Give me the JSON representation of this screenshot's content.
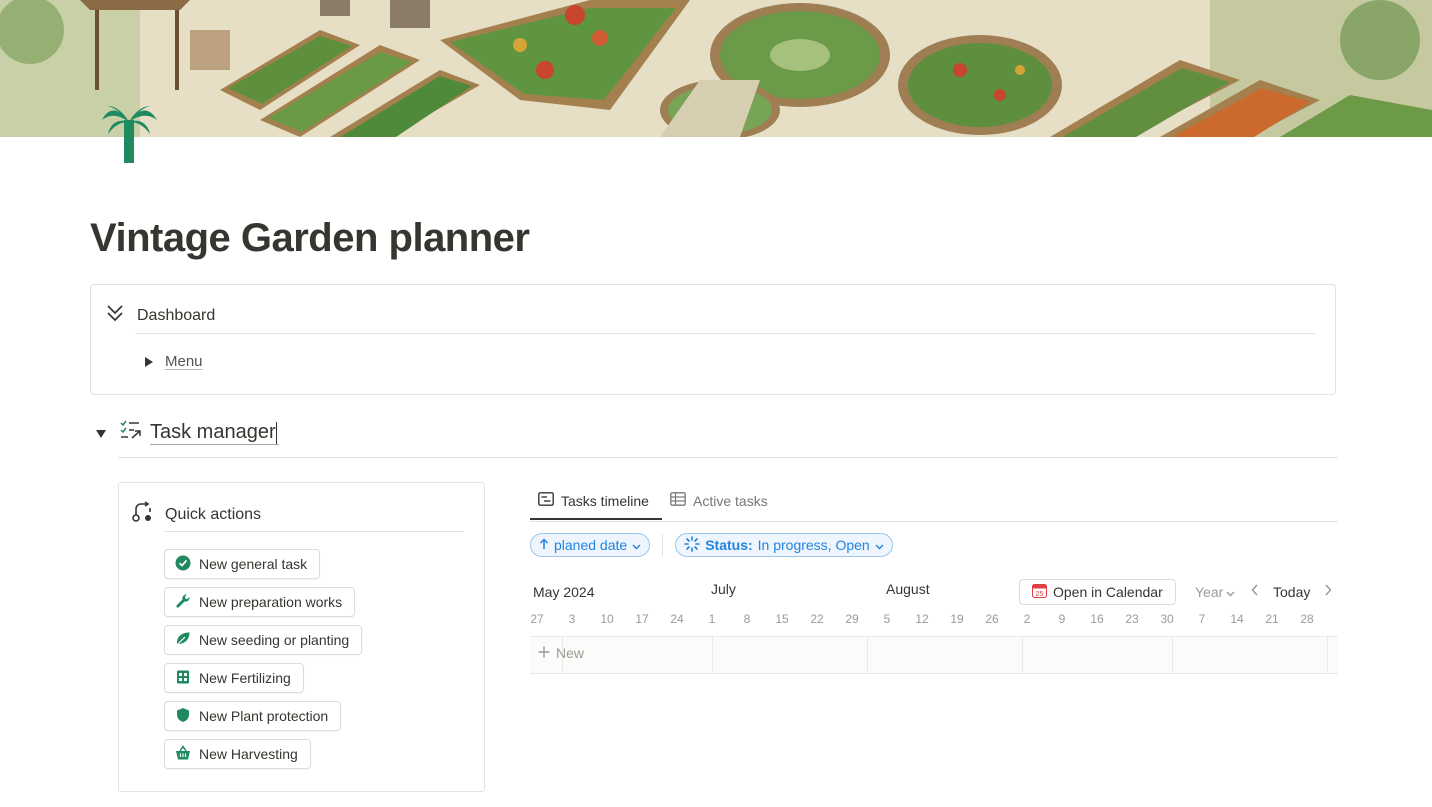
{
  "page": {
    "title": "Vintage Garden planner",
    "cover_alt": "Illustrated vintage vegetable garden with raised beds",
    "accent_color": "#1f8a5f"
  },
  "dashboard": {
    "title": "Dashboard",
    "menu_label": "Menu"
  },
  "task_manager": {
    "title": "Task manager"
  },
  "quick_actions": {
    "title": "Quick actions",
    "buttons": [
      {
        "label": "New general task",
        "icon": "check-circle-icon"
      },
      {
        "label": "New preparation works",
        "icon": "wrench-icon"
      },
      {
        "label": "New seeding or planting",
        "icon": "leaf-icon"
      },
      {
        "label": "New Fertilizing",
        "icon": "grid-icon"
      },
      {
        "label": "New Plant protection",
        "icon": "shield-icon"
      },
      {
        "label": "New Harvesting",
        "icon": "basket-icon"
      }
    ]
  },
  "views": {
    "tabs": [
      {
        "label": "Tasks timeline",
        "icon": "timeline-icon",
        "active": true
      },
      {
        "label": "Active tasks",
        "icon": "table-icon",
        "active": false
      }
    ]
  },
  "filters": {
    "sort_label": "planed date",
    "status_key": "Status:",
    "status_value": "In progress, Open"
  },
  "timeline": {
    "months": [
      "May 2024",
      "July",
      "August"
    ],
    "days": [
      "27",
      "3",
      "10",
      "17",
      "24",
      "1",
      "8",
      "15",
      "22",
      "29",
      "5",
      "12",
      "19",
      "26",
      "2",
      "9",
      "16",
      "23",
      "30",
      "7",
      "14",
      "21",
      "28"
    ],
    "open_calendar_label": "Open in Calendar",
    "calendar_day": "25",
    "scale_label": "Year",
    "today_label": "Today",
    "new_label": "New"
  }
}
